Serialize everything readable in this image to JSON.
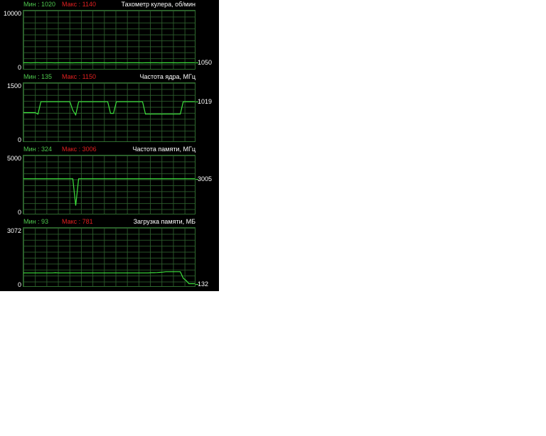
{
  "panels": [
    {
      "title": "Тахометр кулера, об/мин",
      "min_label": "Мин : 1020",
      "max_label": "Макс : 1140",
      "axis_max": "10000",
      "axis_min": "0",
      "current": "1050",
      "range": [
        0,
        10000
      ],
      "current_value": 1050,
      "series": [
        1050,
        1060,
        1040,
        1050,
        1070,
        1040,
        1050,
        1060,
        1050,
        1040,
        1050,
        1060,
        1050,
        1050,
        1040,
        1060,
        1050,
        1050,
        1060,
        1040,
        1050,
        1050,
        1060,
        1050,
        1040,
        1050,
        1060,
        1050,
        1050,
        1040,
        1050,
        1060,
        1050,
        1050,
        1040,
        1060,
        1050,
        1050,
        1060,
        1040,
        1050,
        1050,
        1060,
        1050,
        1040,
        1050,
        1060,
        1050,
        1050,
        1050
      ]
    },
    {
      "title": "Частота ядра, МГц",
      "min_label": "Мин : 135",
      "max_label": "Макс : 1150",
      "axis_max": "1500",
      "axis_min": "0",
      "current": "1019",
      "range": [
        0,
        1500
      ],
      "current_value": 1019,
      "series": [
        740,
        740,
        740,
        740,
        740,
        700,
        1019,
        1019,
        1019,
        1019,
        1019,
        1019,
        1019,
        1019,
        1019,
        1019,
        1019,
        800,
        680,
        1019,
        1019,
        1019,
        1019,
        1019,
        1019,
        1019,
        1019,
        1019,
        1019,
        1019,
        720,
        720,
        1019,
        1019,
        1019,
        1019,
        1019,
        1019,
        1019,
        1019,
        1019,
        1019,
        700,
        700,
        700,
        700,
        700,
        700,
        700,
        700,
        700,
        700,
        700,
        700,
        700,
        1019,
        1019,
        1019,
        1019,
        1019
      ]
    },
    {
      "title": "Частота памяти, МГц",
      "min_label": "Мин : 324",
      "max_label": "Макс : 3006",
      "axis_max": "5000",
      "axis_min": "0",
      "current": "3005",
      "range": [
        0,
        5000
      ],
      "current_value": 3005,
      "series": [
        3005,
        3005,
        3005,
        3005,
        3005,
        3005,
        3005,
        3005,
        3005,
        3005,
        3005,
        3005,
        3005,
        3005,
        3005,
        3005,
        3005,
        3005,
        700,
        3005,
        3005,
        3005,
        3005,
        3005,
        3005,
        3005,
        3005,
        3005,
        3005,
        3005,
        3005,
        3005,
        3005,
        3005,
        3005,
        3005,
        3005,
        3005,
        3005,
        3005,
        3005,
        3005,
        3005,
        3005,
        3005,
        3005,
        3005,
        3005,
        3005,
        3005,
        3005,
        3005,
        3005,
        3005,
        3005,
        3005,
        3005,
        3005,
        3005,
        3005
      ]
    },
    {
      "title": "Загрузка памяти, МБ",
      "min_label": "Мин : 93",
      "max_label": "Макс : 781",
      "axis_max": "3072",
      "axis_min": "0",
      "current": "132",
      "range": [
        0,
        3072
      ],
      "current_value": 132,
      "series": [
        700,
        700,
        700,
        700,
        700,
        700,
        700,
        700,
        700,
        700,
        700,
        710,
        700,
        700,
        700,
        700,
        700,
        700,
        700,
        700,
        700,
        700,
        700,
        700,
        700,
        700,
        700,
        700,
        700,
        700,
        700,
        700,
        700,
        700,
        700,
        700,
        700,
        700,
        700,
        700,
        700,
        700,
        700,
        700,
        710,
        710,
        720,
        730,
        740,
        760,
        760,
        760,
        760,
        760,
        760,
        420,
        300,
        132,
        132,
        132
      ]
    }
  ]
}
